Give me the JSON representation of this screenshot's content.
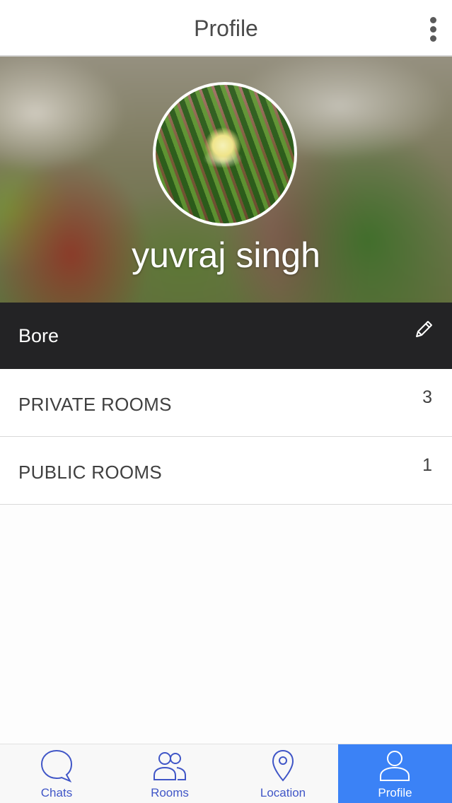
{
  "header": {
    "title": "Profile",
    "menu_icon": "more-vertical-icon"
  },
  "profile": {
    "name": "yuvraj singh",
    "avatar_icon": "profile-photo",
    "status": "Bore",
    "edit_icon": "pencil-icon"
  },
  "rooms": [
    {
      "label": "PRIVATE ROOMS",
      "count": "3"
    },
    {
      "label": "PUBLIC ROOMS",
      "count": "1"
    }
  ],
  "tabs": [
    {
      "label": "Chats",
      "icon": "chat-bubble-icon",
      "active": false
    },
    {
      "label": "Rooms",
      "icon": "people-icon",
      "active": false
    },
    {
      "label": "Location",
      "icon": "location-pin-icon",
      "active": false
    },
    {
      "label": "Profile",
      "icon": "person-icon",
      "active": true
    }
  ],
  "colors": {
    "accent": "#3b82f6",
    "tab_label": "#4056c7",
    "status_bar_bg": "#232325",
    "header_text": "#4a4a4a"
  }
}
